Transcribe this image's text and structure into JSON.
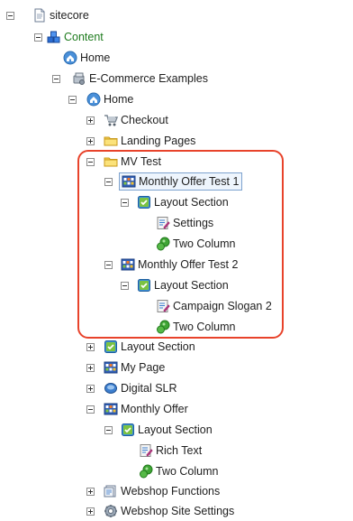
{
  "tree": {
    "nodes": [
      {
        "label": "sitecore",
        "icon": "document-icon",
        "toggle": "minus"
      },
      {
        "label": "Content",
        "icon": "content-cubes-icon",
        "toggle": "minus"
      },
      {
        "label": "Home",
        "icon": "home-icon",
        "toggle": "none"
      },
      {
        "label": "E-Commerce Examples",
        "icon": "ecommerce-icon",
        "toggle": "minus"
      },
      {
        "label": "Home",
        "icon": "home-icon",
        "toggle": "minus"
      },
      {
        "label": "Checkout",
        "icon": "checkout-cart-icon",
        "toggle": "plus"
      },
      {
        "label": "Landing Pages",
        "icon": "folder-icon",
        "toggle": "plus"
      },
      {
        "label": "MV Test",
        "icon": "folder-icon",
        "toggle": "minus"
      },
      {
        "label": "Monthly Offer Test 1",
        "icon": "grid-page-icon",
        "toggle": "minus",
        "selected": true
      },
      {
        "label": "Layout Section",
        "icon": "layout-section-icon",
        "toggle": "minus"
      },
      {
        "label": "Settings",
        "icon": "rich-text-icon",
        "toggle": "none"
      },
      {
        "label": "Two Column",
        "icon": "green-blob-icon",
        "toggle": "none"
      },
      {
        "label": "Monthly Offer Test 2",
        "icon": "grid-page-icon",
        "toggle": "minus"
      },
      {
        "label": "Layout Section",
        "icon": "layout-section-icon",
        "toggle": "minus"
      },
      {
        "label": "Campaign Slogan 2",
        "icon": "rich-text-icon",
        "toggle": "none"
      },
      {
        "label": "Two Column",
        "icon": "green-blob-icon",
        "toggle": "none"
      },
      {
        "label": "Layout Section",
        "icon": "layout-section-icon",
        "toggle": "plus"
      },
      {
        "label": "My Page",
        "icon": "grid-page-icon",
        "toggle": "plus"
      },
      {
        "label": "Digital SLR",
        "icon": "camera-icon",
        "toggle": "plus"
      },
      {
        "label": "Monthly Offer",
        "icon": "grid-page-icon",
        "toggle": "minus"
      },
      {
        "label": "Layout Section",
        "icon": "layout-section-icon",
        "toggle": "minus"
      },
      {
        "label": "Rich Text",
        "icon": "rich-text-icon",
        "toggle": "none"
      },
      {
        "label": "Two Column",
        "icon": "green-blob-icon",
        "toggle": "none"
      },
      {
        "label": "Webshop Functions",
        "icon": "webshop-functions-icon",
        "toggle": "plus"
      },
      {
        "label": "Webshop Site Settings",
        "icon": "gear-icon",
        "toggle": "plus"
      }
    ]
  },
  "colors": {
    "highlight": "#e8432b",
    "selection_border": "#7da2ce",
    "selection_bg": "#eef5fd",
    "content_label": "#1e7b1e"
  }
}
